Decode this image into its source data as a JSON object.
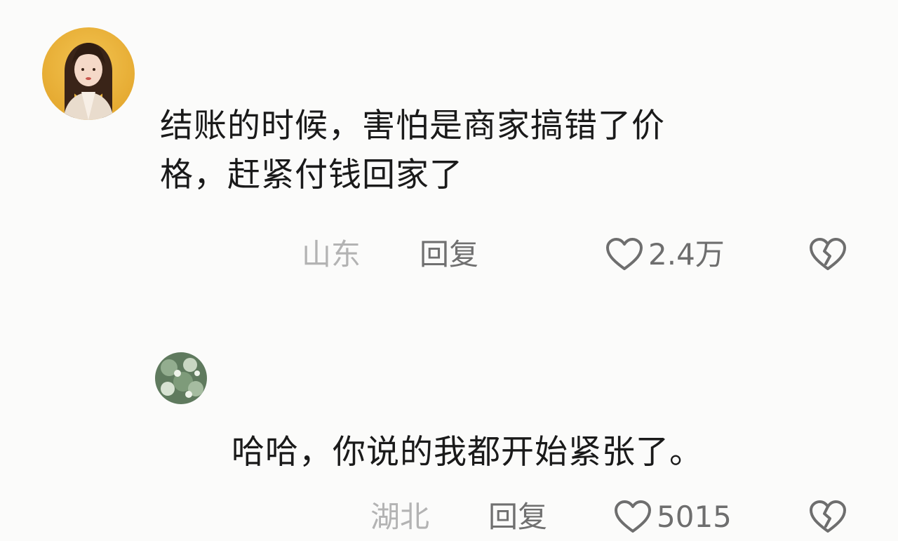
{
  "comments": [
    {
      "avatar": "woman-portrait-avatar",
      "text_line1": "结账的时候，害怕是商家搞错了价",
      "text_line2": "格，赶紧付钱回家了",
      "location": "山东",
      "reply_label": "回复",
      "like_count": "2.4万"
    },
    {
      "avatar": "green-floral-avatar",
      "text_line1": "哈哈，你说的我都开始紧张了。",
      "location": "湖北",
      "reply_label": "回复",
      "like_count": "5015"
    }
  ],
  "icons": {
    "like": "heart-outline-icon",
    "dislike": "broken-heart-icon"
  },
  "colors": {
    "background": "#fbfbfa",
    "text": "#1a1a1a",
    "location": "#b3b3b3",
    "secondary": "#707070"
  }
}
